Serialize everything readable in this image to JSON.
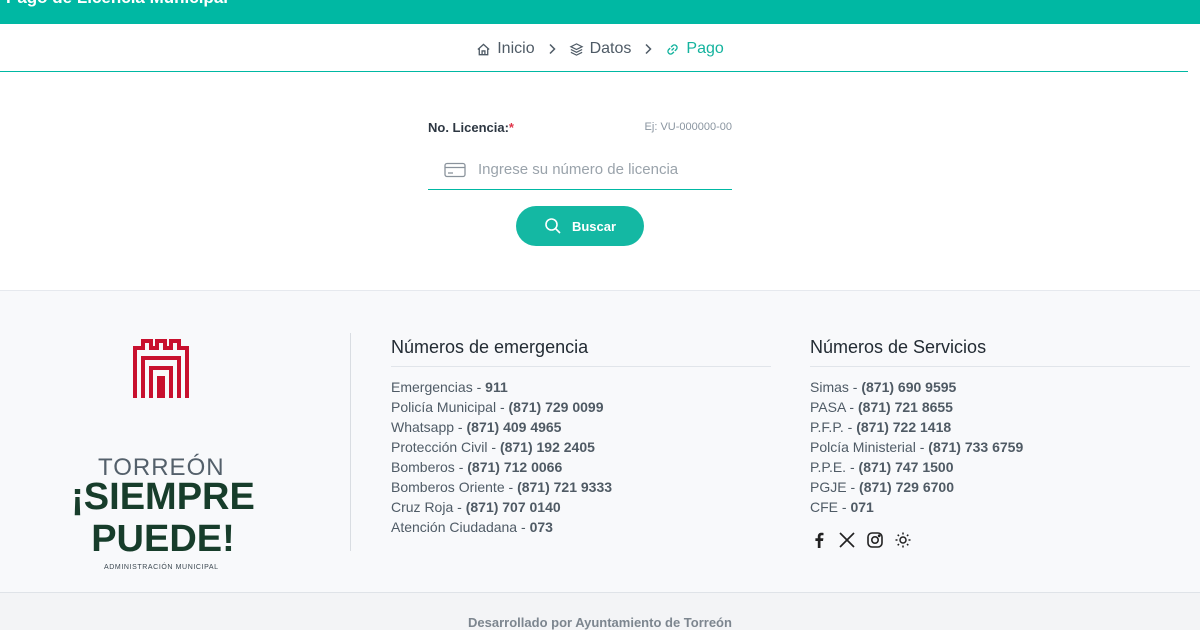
{
  "topbar": {
    "title": "Pago de Licencia Municipal"
  },
  "breadcrumb": {
    "items": [
      {
        "label": "Inicio",
        "icon": "home-icon"
      },
      {
        "label": "Datos",
        "icon": "layers-icon"
      },
      {
        "label": "Pago",
        "icon": "link-icon"
      }
    ]
  },
  "form": {
    "label": "No. Licencia:",
    "required_mark": "*",
    "hint": "Ej: VU-000000-00",
    "placeholder": "Ingrese su número de licencia",
    "value": "",
    "button_label": "Buscar"
  },
  "logo": {
    "city": "TORREÓN",
    "slogan_line1": "¡SIEMPRE",
    "slogan_line2": "PUEDE!",
    "subtitle": "ADMINISTRACIÓN MUNICIPAL"
  },
  "emergency": {
    "title": "Números de emergencia",
    "items": [
      {
        "name": "Emergencias",
        "number": "911"
      },
      {
        "name": "Policía Municipal",
        "number": "(871) 729 0099"
      },
      {
        "name": "Whatsapp",
        "number": "(871) 409 4965"
      },
      {
        "name": "Protección Civil",
        "number": "(871) 192 2405"
      },
      {
        "name": "Bomberos",
        "number": "(871) 712 0066"
      },
      {
        "name": "Bomberos Oriente",
        "number": "(871) 721 9333"
      },
      {
        "name": "Cruz Roja",
        "number": "(871) 707 0140"
      },
      {
        "name": "Atención Ciudadana",
        "number": "073"
      }
    ]
  },
  "services": {
    "title": "Números de Servicios",
    "items": [
      {
        "name": "Simas",
        "number": "(871) 690 9595"
      },
      {
        "name": "PASA",
        "number": "(871) 721 8655"
      },
      {
        "name": "P.F.P.",
        "number": "(871) 722 1418"
      },
      {
        "name": "Polcía Ministerial",
        "number": "(871) 733 6759"
      },
      {
        "name": "P.P.E.",
        "number": "(871) 747 1500"
      },
      {
        "name": "PGJE",
        "number": "(871) 729 6700"
      },
      {
        "name": "CFE",
        "number": "071"
      }
    ],
    "social": [
      "facebook-icon",
      "x-icon",
      "instagram-icon",
      "sun-icon"
    ]
  },
  "footer": {
    "credit": "Desarrollado por Ayuntamiento de Torreón"
  },
  "colors": {
    "accent": "#00b8a3",
    "logo_red": "#c8102e",
    "logo_green": "#173d2b"
  }
}
